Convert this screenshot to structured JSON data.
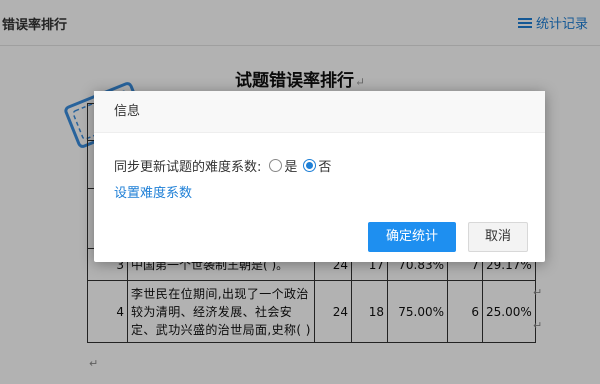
{
  "header": {
    "title": "错误率排行",
    "records_link": "统计记录",
    "records_icon": "menu-icon"
  },
  "document": {
    "title": "试题错误率排行",
    "return_mark": "↵",
    "rows": [
      {
        "no": "3",
        "question": "中国第一个世袭制王朝是( )。",
        "c1": "24",
        "c2": "17",
        "p1": "70.83%",
        "c3": "7",
        "p2": "29.17%"
      },
      {
        "no": "4",
        "question": "李世民在位期间,出现了一个政治较为清明、经济发展、社会安定、武功兴盛的治世局面,史称( )",
        "c1": "24",
        "c2": "18",
        "p1": "75.00%",
        "c3": "6",
        "p2": "25.00%"
      }
    ]
  },
  "dialog": {
    "title": "信息",
    "question_label": "同步更新试题的难度系数:",
    "option_yes": "是",
    "option_no": "否",
    "selected": "否",
    "settings_link": "设置难度系数",
    "confirm_button": "确定统计",
    "cancel_button": "取消"
  },
  "colors": {
    "accent": "#1e7fd6",
    "primary_button": "#1e8ff0",
    "overlay": "rgba(0,0,0,0.30)"
  }
}
